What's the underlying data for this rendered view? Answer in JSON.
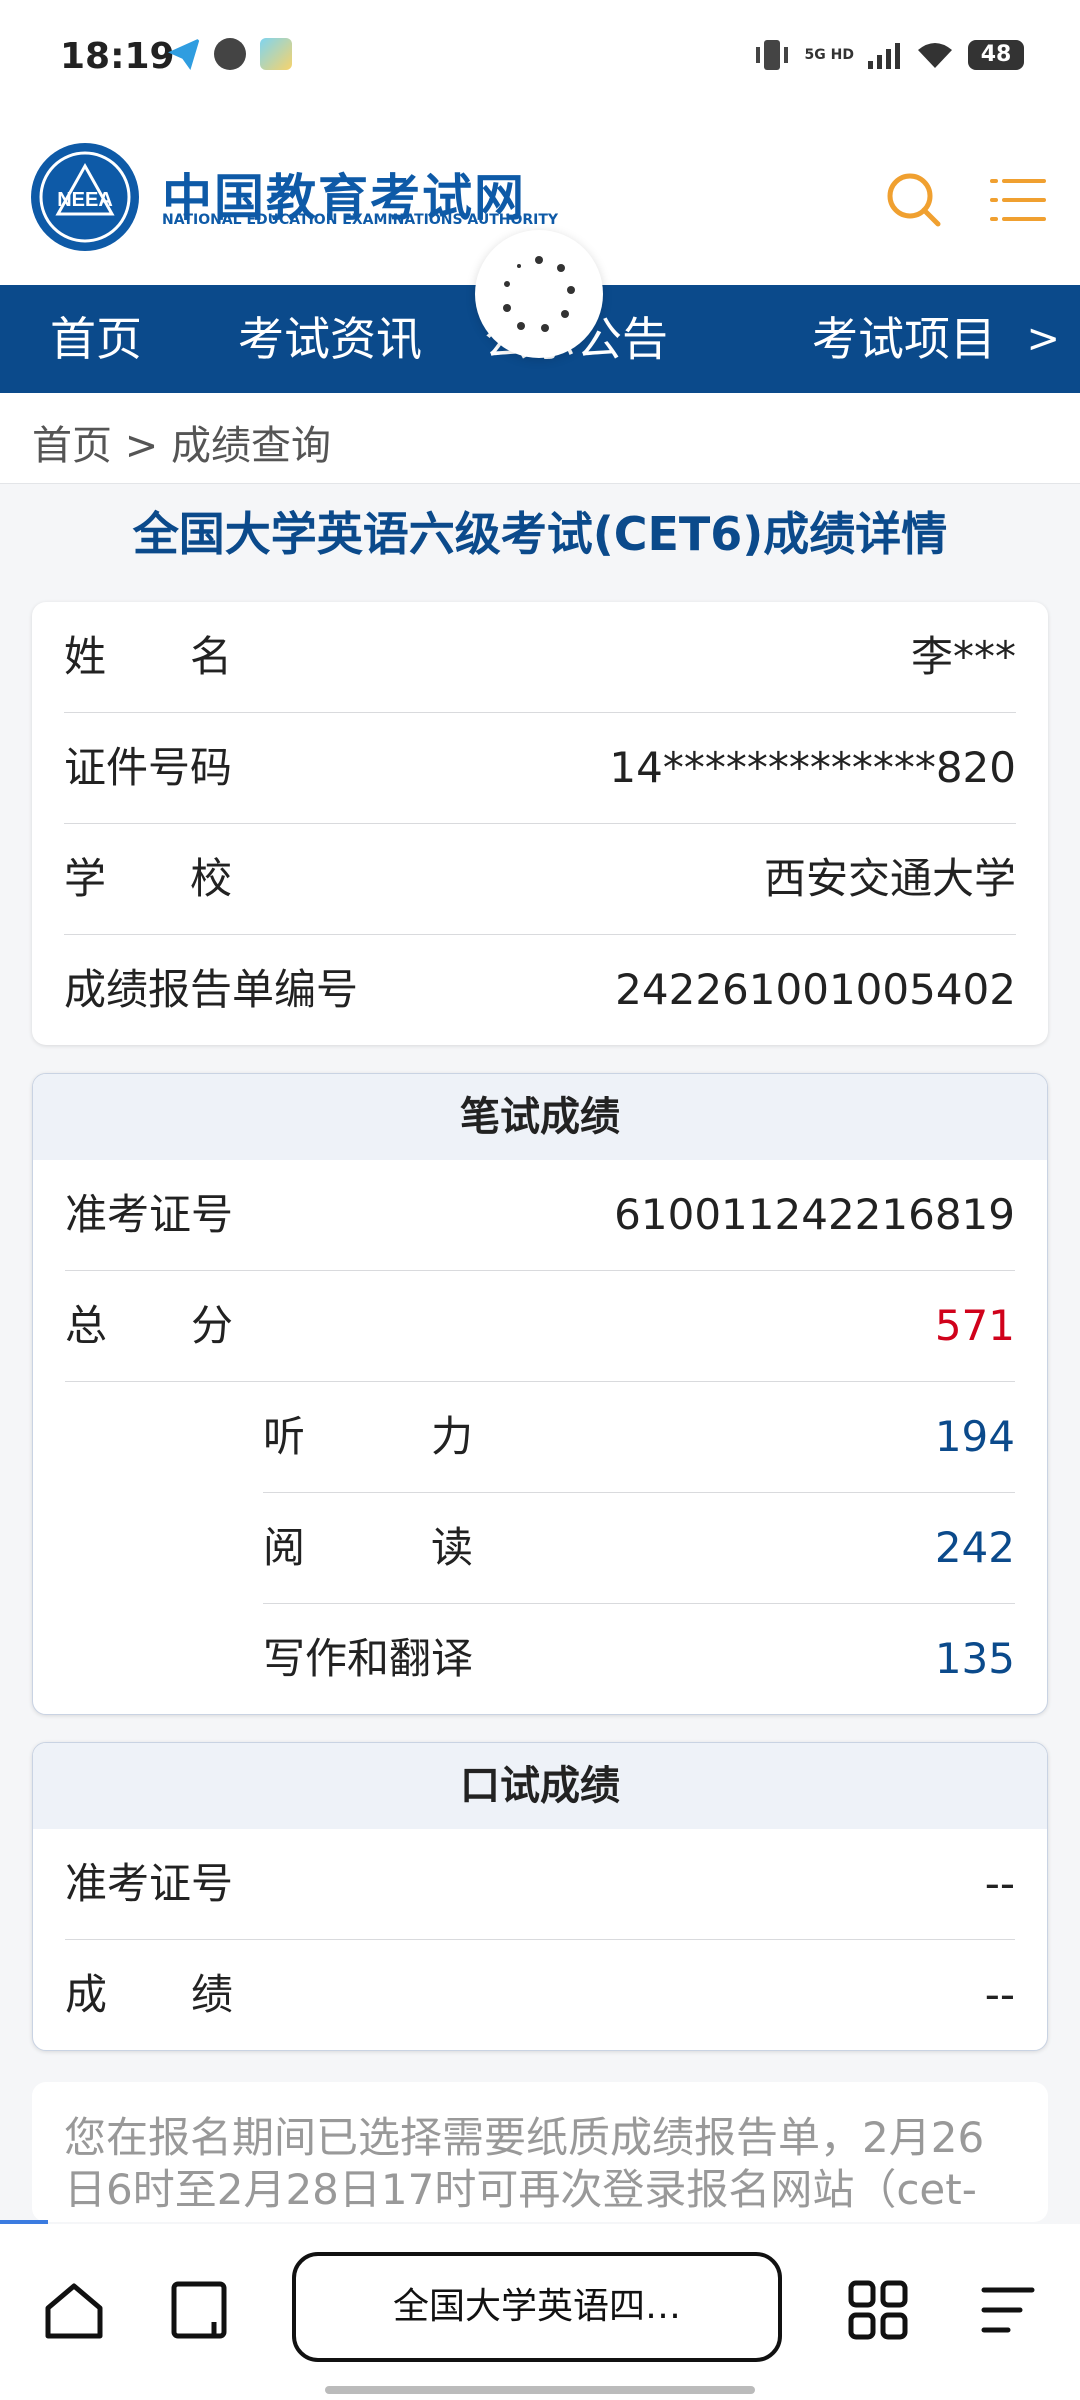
{
  "status_bar": {
    "time": "18:19",
    "network": "5G HD",
    "battery": "48"
  },
  "site": {
    "logo_text": "NEEA",
    "name": "中国教育考试网",
    "subtitle": "NATIONAL EDUCATION EXAMINATIONS AUTHORITY",
    "icons": {
      "search": "search-icon",
      "menu": "menu-icon"
    },
    "colors": {
      "brand": "#0b4a8b",
      "accent": "#f0a030",
      "score_total": "#d0021b"
    }
  },
  "nav": {
    "items": [
      "首页",
      "考试资讯",
      "公示公告",
      "考试项目"
    ],
    "more": ">"
  },
  "breadcrumb": "首页 > 成绩查询",
  "page_title": "全国大学英语六级考试(CET6)成绩详情",
  "personal": [
    {
      "label": "姓　　名",
      "value": "李***"
    },
    {
      "label": "证件号码",
      "value": "14*************820"
    },
    {
      "label": "学　　校",
      "value": "西安交通大学"
    },
    {
      "label": "成绩报告单编号",
      "value": "242261001005402"
    }
  ],
  "written": {
    "title": "笔试成绩",
    "admission_label": "准考证号",
    "admission_value": "610011242216819",
    "total_label": "总　　分",
    "total_value": "571",
    "sections": [
      {
        "label": "听　　　力",
        "value": "194"
      },
      {
        "label": "阅　　　读",
        "value": "242"
      },
      {
        "label": "写作和翻译",
        "value": "135"
      }
    ]
  },
  "oral": {
    "title": "口试成绩",
    "admission_label": "准考证号",
    "admission_value": "--",
    "score_label": "成　　绩",
    "score_value": "--"
  },
  "notice": "您在报名期间已选择需要纸质成绩报告单，2月26日6时至2月28日17时可再次登录报名网站（cet-",
  "browser": {
    "address": "全国大学英语四…",
    "icons": [
      "home-icon",
      "tabs-icon",
      "apps-icon",
      "menu-icon"
    ]
  }
}
